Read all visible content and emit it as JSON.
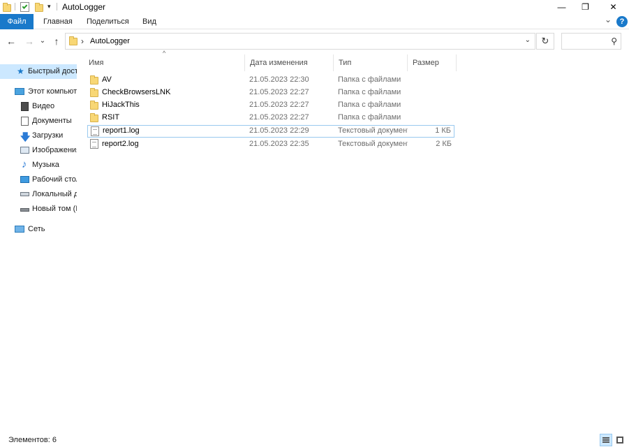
{
  "window": {
    "title": "AutoLogger",
    "minimize_glyph": "—",
    "maximize_glyph": "❐",
    "close_glyph": "✕"
  },
  "ribbon": {
    "tabs": [
      "Файл",
      "Главная",
      "Поделиться",
      "Вид"
    ],
    "collapse_glyph": "⌄",
    "help_glyph": "?"
  },
  "nav": {
    "back_glyph": "←",
    "forward_glyph": "→",
    "recent_glyph": "⌄",
    "up_glyph": "↑",
    "breadcrumb_sep": "›",
    "path": "AutoLogger",
    "dropdown_glyph": "⌄",
    "refresh_glyph": "↻",
    "search_glyph": "⚲",
    "search_placeholder": ""
  },
  "sidebar": {
    "items": [
      {
        "label": "Быстрый доступ",
        "icon": "star-icon",
        "indent": 1,
        "active": true
      },
      {
        "label": "Этот компьютер",
        "icon": "computer-icon",
        "indent": 1,
        "active": false
      },
      {
        "label": "Видео",
        "icon": "video-icon",
        "indent": 2,
        "active": false
      },
      {
        "label": "Документы",
        "icon": "documents-icon",
        "indent": 2,
        "active": false
      },
      {
        "label": "Загрузки",
        "icon": "downloads-icon",
        "indent": 2,
        "active": false
      },
      {
        "label": "Изображения",
        "icon": "pictures-icon",
        "indent": 2,
        "active": false
      },
      {
        "label": "Музыка",
        "icon": "music-icon",
        "indent": 2,
        "active": false
      },
      {
        "label": "Рабочий стол",
        "icon": "desktop-icon",
        "indent": 2,
        "active": false
      },
      {
        "label": "Локальный диск (C:)",
        "icon": "drive-icon",
        "indent": 2,
        "active": false
      },
      {
        "label": "Новый том (D:)",
        "icon": "drive-icon",
        "indent": 2,
        "active": false
      },
      {
        "label": "Сеть",
        "icon": "network-icon",
        "indent": 1,
        "active": false
      }
    ]
  },
  "columns": {
    "name": "Имя",
    "date": "Дата изменения",
    "type": "Тип",
    "size": "Размер",
    "sort_glyph": "^"
  },
  "files": [
    {
      "name": "AV",
      "date": "21.05.2023 22:30",
      "type": "Папка с файлами",
      "size": "",
      "kind": "folder",
      "selected": false
    },
    {
      "name": "CheckBrowsersLNK",
      "date": "21.05.2023 22:27",
      "type": "Папка с файлами",
      "size": "",
      "kind": "folder",
      "selected": false
    },
    {
      "name": "HiJackThis",
      "date": "21.05.2023 22:27",
      "type": "Папка с файлами",
      "size": "",
      "kind": "folder",
      "selected": false
    },
    {
      "name": "RSIT",
      "date": "21.05.2023 22:27",
      "type": "Папка с файлами",
      "size": "",
      "kind": "folder",
      "selected": false
    },
    {
      "name": "report1.log",
      "date": "21.05.2023 22:29",
      "type": "Текстовый документ",
      "size": "1 КБ",
      "kind": "file",
      "selected": true
    },
    {
      "name": "report2.log",
      "date": "21.05.2023 22:35",
      "type": "Текстовый документ",
      "size": "2 КБ",
      "kind": "file",
      "selected": false
    }
  ],
  "status": {
    "text": "Элементов: 6"
  },
  "colors": {
    "accent": "#1979ca",
    "selection": "#cce8ff",
    "selection_border": "#99c9ef",
    "folder": "#f8d775"
  }
}
